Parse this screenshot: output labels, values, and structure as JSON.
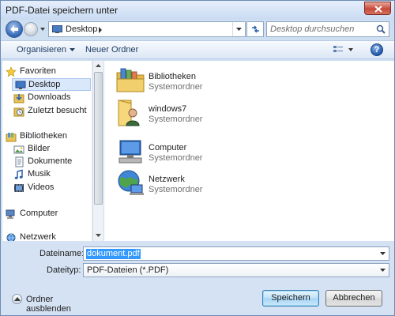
{
  "window": {
    "title": "PDF-Datei speichern unter"
  },
  "navigation": {
    "address": "Desktop",
    "search_placeholder": "Desktop durchsuchen"
  },
  "toolbar": {
    "organize_label": "Organisieren",
    "new_folder_label": "Neuer Ordner",
    "help_label": "?"
  },
  "nav_pane": {
    "items": [
      {
        "label": "Favoriten",
        "icon": "star-icon"
      },
      {
        "label": "Desktop",
        "icon": "desktop-icon",
        "selected": true
      },
      {
        "label": "Downloads",
        "icon": "downloads-icon"
      },
      {
        "label": "Zuletzt besucht",
        "icon": "recent-places-icon"
      },
      {
        "label": "Bibliotheken",
        "icon": "libraries-icon"
      },
      {
        "label": "Bilder",
        "icon": "pictures-icon"
      },
      {
        "label": "Dokumente",
        "icon": "documents-icon"
      },
      {
        "label": "Musik",
        "icon": "music-icon"
      },
      {
        "label": "Videos",
        "icon": "videos-icon"
      },
      {
        "label": "Computer",
        "icon": "computer-icon"
      },
      {
        "label": "Netzwerk",
        "icon": "network-icon"
      }
    ]
  },
  "content": {
    "items": [
      {
        "name": "Bibliotheken",
        "type": "Systemordner",
        "icon": "libraries-folder-icon"
      },
      {
        "name": "windows7",
        "type": "Systemordner",
        "icon": "user-folder-icon"
      },
      {
        "name": "Computer",
        "type": "Systemordner",
        "icon": "computer-icon"
      },
      {
        "name": "Netzwerk",
        "type": "Systemordner",
        "icon": "network-globe-icon"
      }
    ]
  },
  "form": {
    "filename_label": "Dateiname:",
    "filename_value": "dokument.pdf",
    "filetype_label": "Dateityp:",
    "filetype_value": "PDF-Dateien (*.PDF)"
  },
  "footer": {
    "hide_folders_label": "Ordner ausblenden",
    "save_label": "Speichern",
    "cancel_label": "Abbrechen"
  },
  "colors": {
    "selection": "#3399ff",
    "window_frame": "#cfdff2",
    "close_button": "#c8493a"
  }
}
